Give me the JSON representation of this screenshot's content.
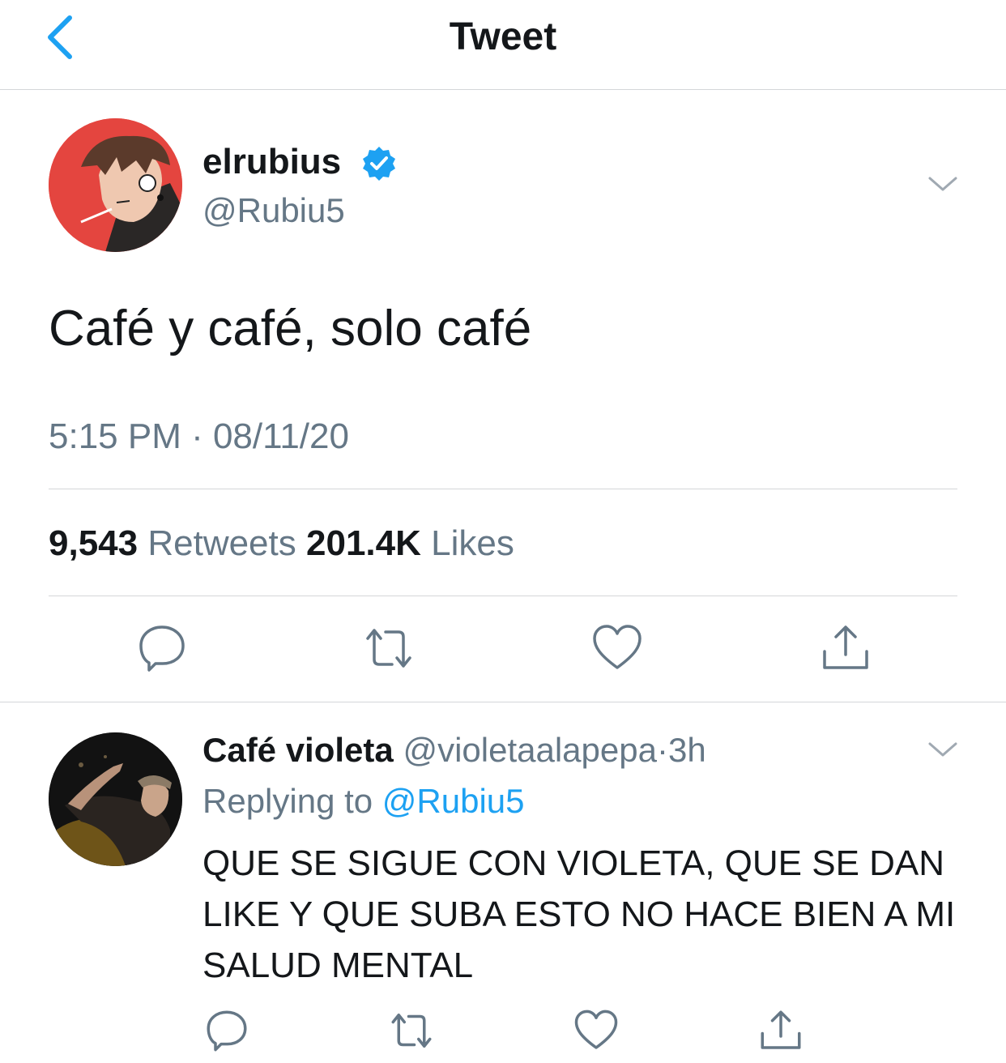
{
  "header": {
    "title": "Tweet"
  },
  "tweet": {
    "author_name": "elrubius",
    "author_handle": "@Rubiu5",
    "text": "Café y café, solo café",
    "timestamp": "5:15 PM · 08/11/20",
    "retweet_count": "9,543",
    "retweet_label": "Retweets",
    "like_count": "201.4K",
    "like_label": "Likes"
  },
  "reply": {
    "author_name": "Café violeta",
    "author_handle": "@violetaalapepa",
    "separator": "·",
    "time": "3h",
    "replying_prefix": "Replying to",
    "replying_to": "@Rubiu5",
    "text": "QUE SE SIGUE CON VIOLETA, QUE SE DAN LIKE Y QUE SUBA ESTO NO HACE BIEN A MI SALUD MENTAL"
  },
  "colors": {
    "accent": "#1da1f2",
    "secondary_text": "#657786",
    "action_icon": "#657786",
    "avatar_bg": "#e4453f"
  },
  "icons": [
    "back-chevron-icon",
    "verified-badge-icon",
    "chevron-down-icon",
    "reply-icon",
    "retweet-icon",
    "like-icon",
    "share-icon"
  ]
}
